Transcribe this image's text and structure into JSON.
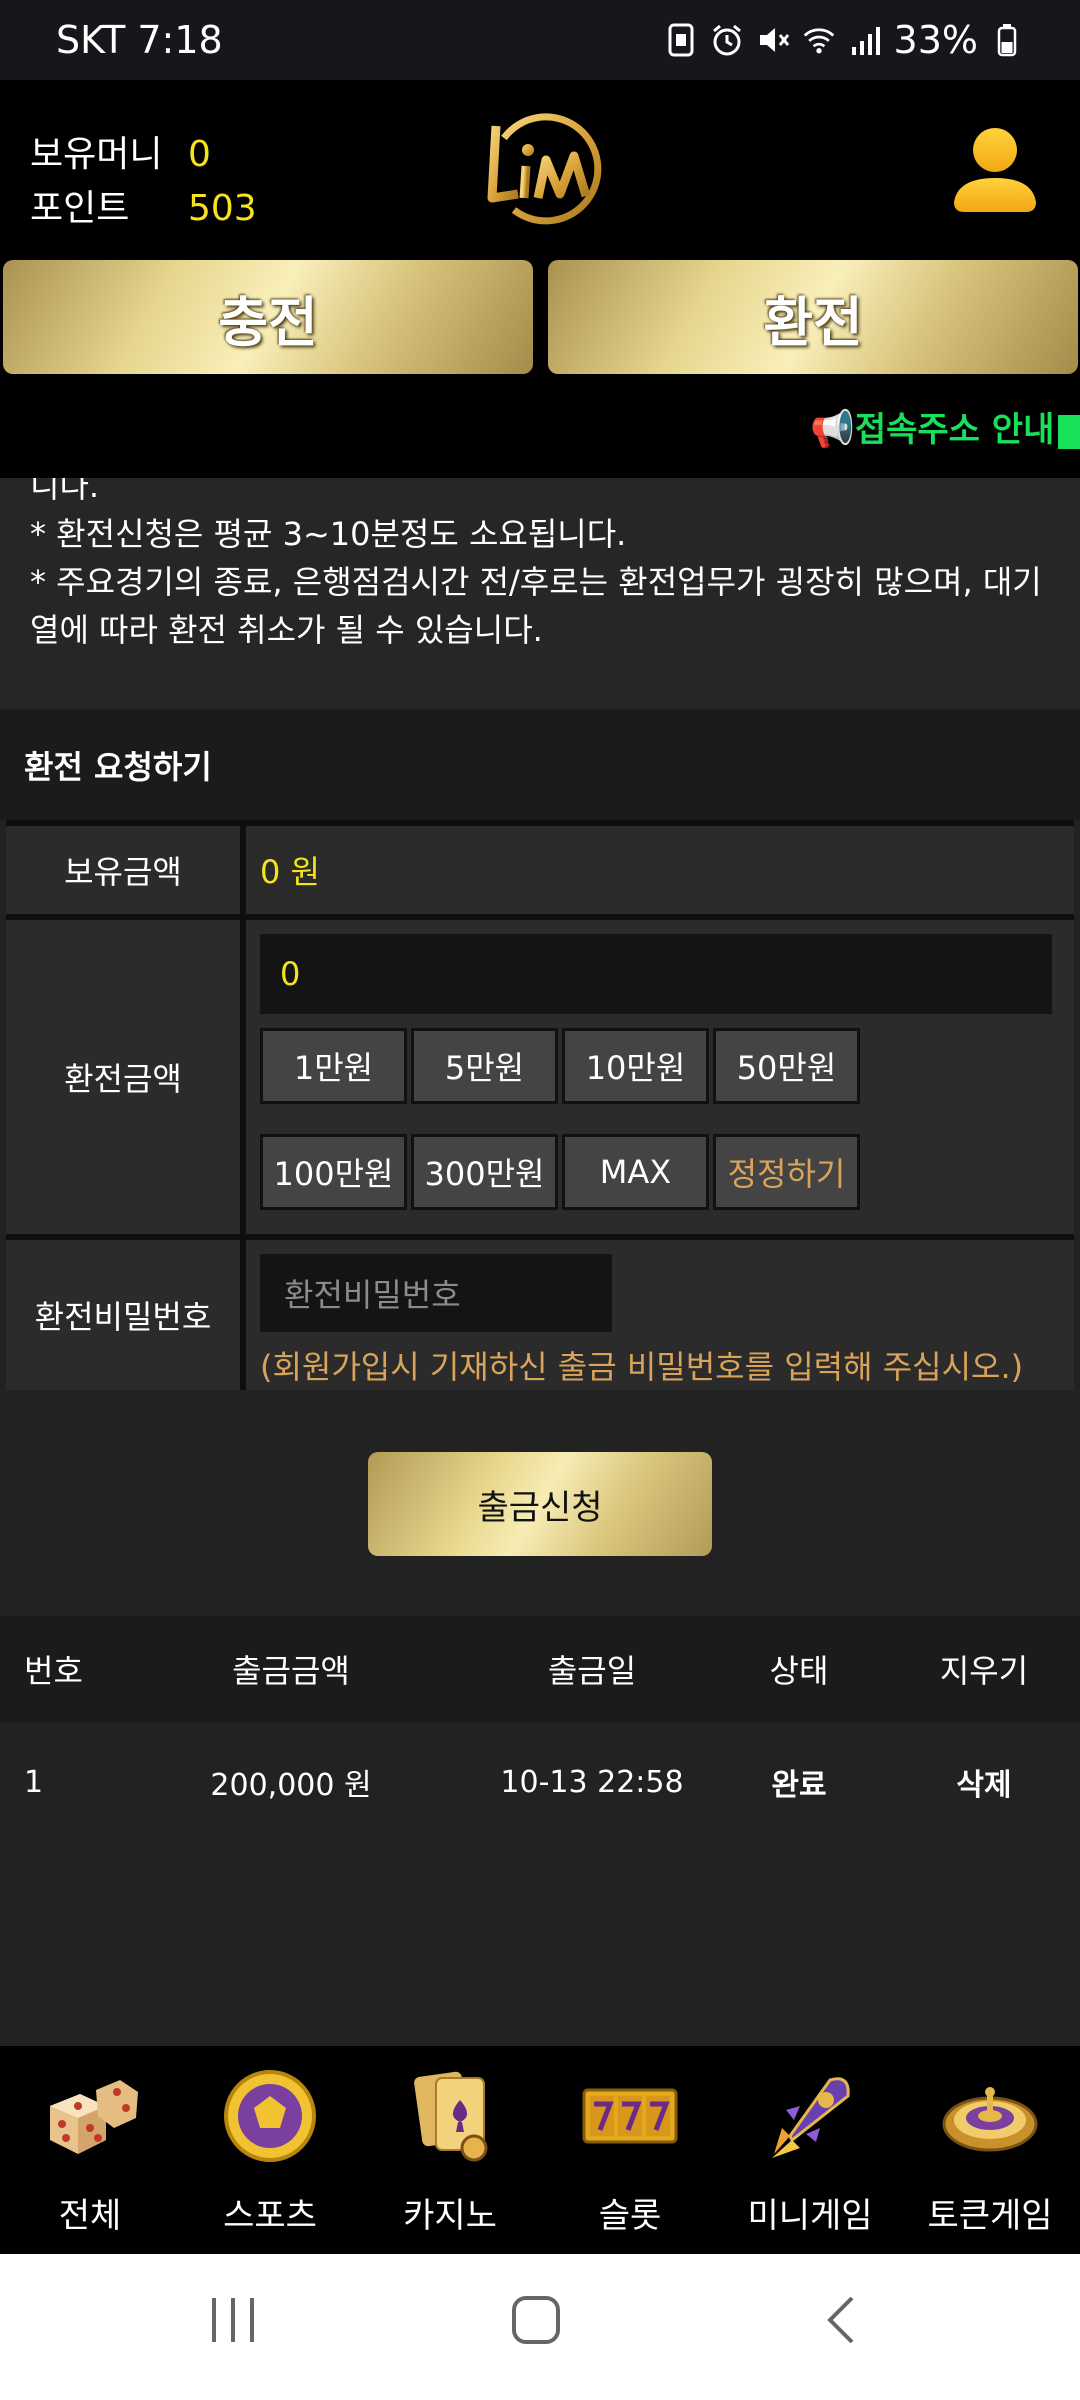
{
  "status_bar": {
    "time": "SKT 7:18",
    "battery": "33%",
    "icons": [
      "sim-icon",
      "alarm-icon",
      "mute-icon",
      "wifi-icon",
      "signal-icon",
      "battery-icon"
    ]
  },
  "header": {
    "money_label": "보유머니",
    "money_value": "0",
    "point_label": "포인트",
    "point_value": "503",
    "logo_icon": "lim-logo",
    "user_icon": "user-icon"
  },
  "top_buttons": {
    "deposit": "충전",
    "withdraw": "환전"
  },
  "ticker": {
    "icon": "megaphone-icon",
    "text": "접속주소 안내"
  },
  "notice": {
    "cut_line": "니다.",
    "line1": "* 환전신청은 평균 3~10분정도 소요됩니다.",
    "line2": "* 주요경기의 종료, 은행점검시간 전/후로는 환전업무가 굉장히 많으며, 대기열에 따라 환전 취소가 될 수 있습니다."
  },
  "section": {
    "title": "환전 요청하기"
  },
  "form": {
    "balance_label": "보유금액",
    "balance_value": "0 원",
    "amount_label": "환전금액",
    "amount_value": "0",
    "chips_row1": [
      "1만원",
      "5만원",
      "10만원",
      "50만원"
    ],
    "chips_row2": [
      "100만원",
      "300만원",
      "MAX"
    ],
    "reset_label": "정정하기",
    "password_label": "환전비밀번호",
    "password_placeholder": "환전비밀번호",
    "password_hint": "(회원가입시 기재하신 출금 비밀번호를 입력해 주십시오.)"
  },
  "submit": {
    "label": "출금신청"
  },
  "history": {
    "headers": [
      "번호",
      "출금금액",
      "출금일",
      "상태",
      "지우기"
    ],
    "rows": [
      {
        "no": "1",
        "amount": "200,000 원",
        "date": "10-13 22:58",
        "status": "완료",
        "delete": "삭제"
      }
    ]
  },
  "bottom_nav": [
    {
      "label": "전체",
      "icon": "dice-icon"
    },
    {
      "label": "스포츠",
      "icon": "soccer-ball-icon"
    },
    {
      "label": "카지노",
      "icon": "cards-icon"
    },
    {
      "label": "슬롯",
      "icon": "slot-777-icon"
    },
    {
      "label": "미니게임",
      "icon": "rocket-icon"
    },
    {
      "label": "토큰게임",
      "icon": "roulette-icon"
    }
  ],
  "colors": {
    "accent_yellow": "#f5e31b",
    "gold": "#e6d68e",
    "ticker_green": "#19e05a",
    "hint_orange": "#d9a45a"
  }
}
